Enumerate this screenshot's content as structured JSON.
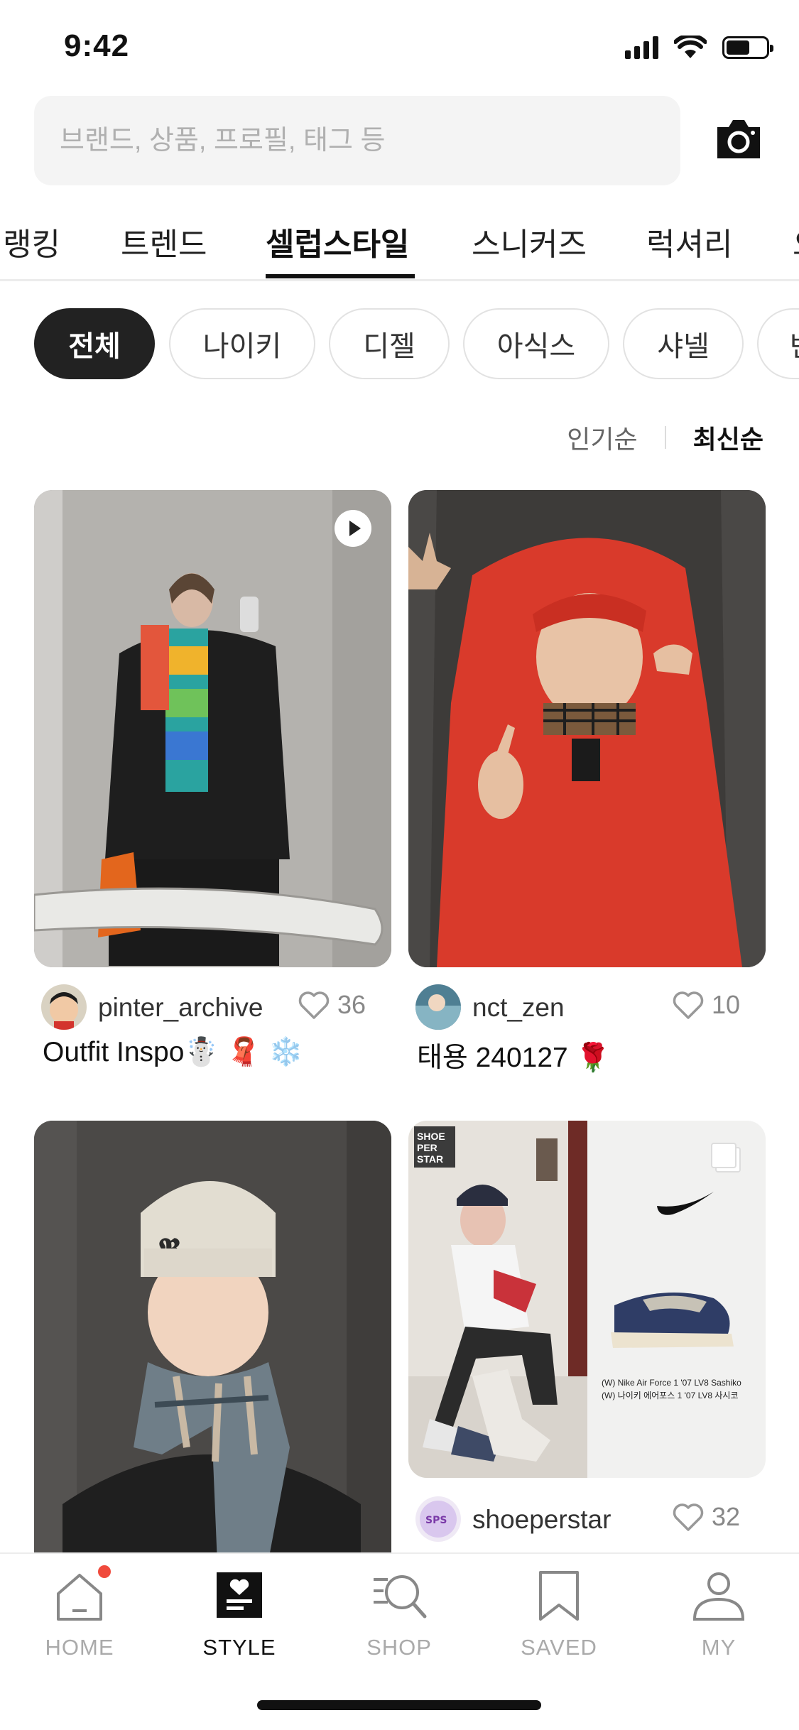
{
  "status": {
    "time": "9:42"
  },
  "search": {
    "placeholder": "브랜드, 상품, 프로필, 태그 등"
  },
  "category_tabs": [
    {
      "label": "랭킹",
      "active": false
    },
    {
      "label": "트렌드",
      "active": false
    },
    {
      "label": "셀럽스타일",
      "active": true
    },
    {
      "label": "스니커즈",
      "active": false
    },
    {
      "label": "럭셔리",
      "active": false
    },
    {
      "label": "오",
      "active": false
    }
  ],
  "brand_chips": [
    {
      "label": "전체",
      "active": true
    },
    {
      "label": "나이키",
      "active": false
    },
    {
      "label": "디젤",
      "active": false
    },
    {
      "label": "아식스",
      "active": false
    },
    {
      "label": "샤넬",
      "active": false
    },
    {
      "label": "반",
      "active": false
    }
  ],
  "sort": {
    "popular": "인기순",
    "latest": "최신순",
    "active": "latest"
  },
  "posts": [
    {
      "username": "pinter_archive",
      "likes": "36",
      "caption": "Outfit Inspo☃️ 🧣 ❄️",
      "media": "video"
    },
    {
      "username": "nct_zen",
      "likes": "10",
      "caption": "태용 240127 🌹",
      "media": "photo"
    },
    {
      "username": "",
      "likes": "",
      "caption": "",
      "media": "photo"
    },
    {
      "username": "shoeperstar",
      "likes": "32",
      "caption": "",
      "media": "multi",
      "badge": "SHOE PER STAR",
      "product_lines": [
        "(W) Nike Air Force 1 '07 LV8 Sashiko",
        "(W) 나이키 에어포스 1 '07 LV8 사시코"
      ]
    }
  ],
  "bottom_nav": [
    {
      "label": "HOME",
      "icon": "home-icon",
      "active": false,
      "badge": true
    },
    {
      "label": "STYLE",
      "icon": "style-icon",
      "active": true,
      "badge": false
    },
    {
      "label": "SHOP",
      "icon": "shop-icon",
      "active": false,
      "badge": false
    },
    {
      "label": "SAVED",
      "icon": "bookmark-icon",
      "active": false,
      "badge": false
    },
    {
      "label": "MY",
      "icon": "profile-icon",
      "active": false,
      "badge": false
    }
  ],
  "colors": {
    "accent": "#111111",
    "notification": "#f04a3c",
    "muted": "#aaaaaa"
  }
}
